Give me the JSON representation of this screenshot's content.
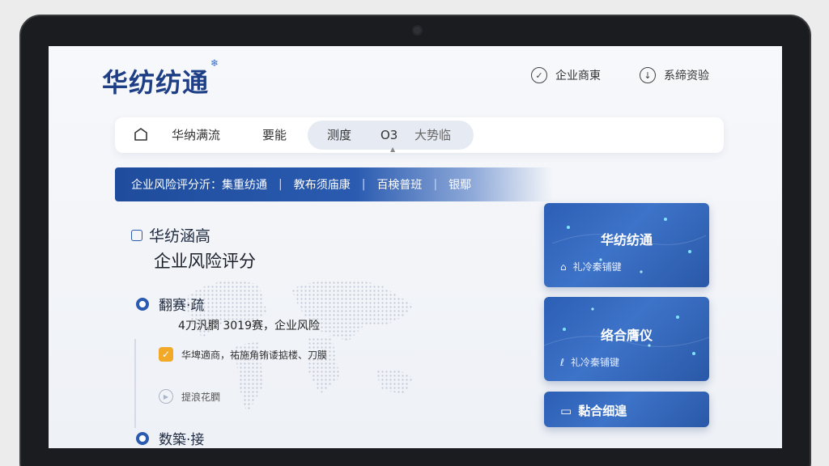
{
  "header": {
    "logo": "华纺纺通",
    "links": [
      {
        "label": "企业商東",
        "icon": "check-circle-icon"
      },
      {
        "label": "系缔资验",
        "icon": "download-circle-icon"
      }
    ]
  },
  "tabs": [
    {
      "label": "华纳满流"
    },
    {
      "label": "要能"
    },
    {
      "label": "测度"
    },
    {
      "label": "O3"
    },
    {
      "label": "大势临"
    }
  ],
  "banner": {
    "items": [
      "企业风险评分沂：集重纺通",
      "教布须庙康",
      "百検普班",
      "银鄢"
    ]
  },
  "main": {
    "section_title": "华纺涵高",
    "subtitle": "企业风险评分",
    "item1": {
      "title": "翻赛·疏",
      "desc": "4刀汎膶 3019赛，企业风险"
    },
    "check_text": "华埤適商，祐施角铕诿掂楼、刀膜",
    "play_text": "提浪花膶",
    "item2": {
      "title": "数築·接"
    }
  },
  "cards": [
    {
      "title": "华纺纺通",
      "sub": "礼冷秦铺键"
    },
    {
      "title": "络合膺仪",
      "sub": "礼冷秦铺键"
    },
    {
      "title": "黏合细遑"
    }
  ],
  "colors": {
    "brand": "#1e3f86",
    "accent": "#2a5bb0",
    "warn": "#f2a928"
  }
}
